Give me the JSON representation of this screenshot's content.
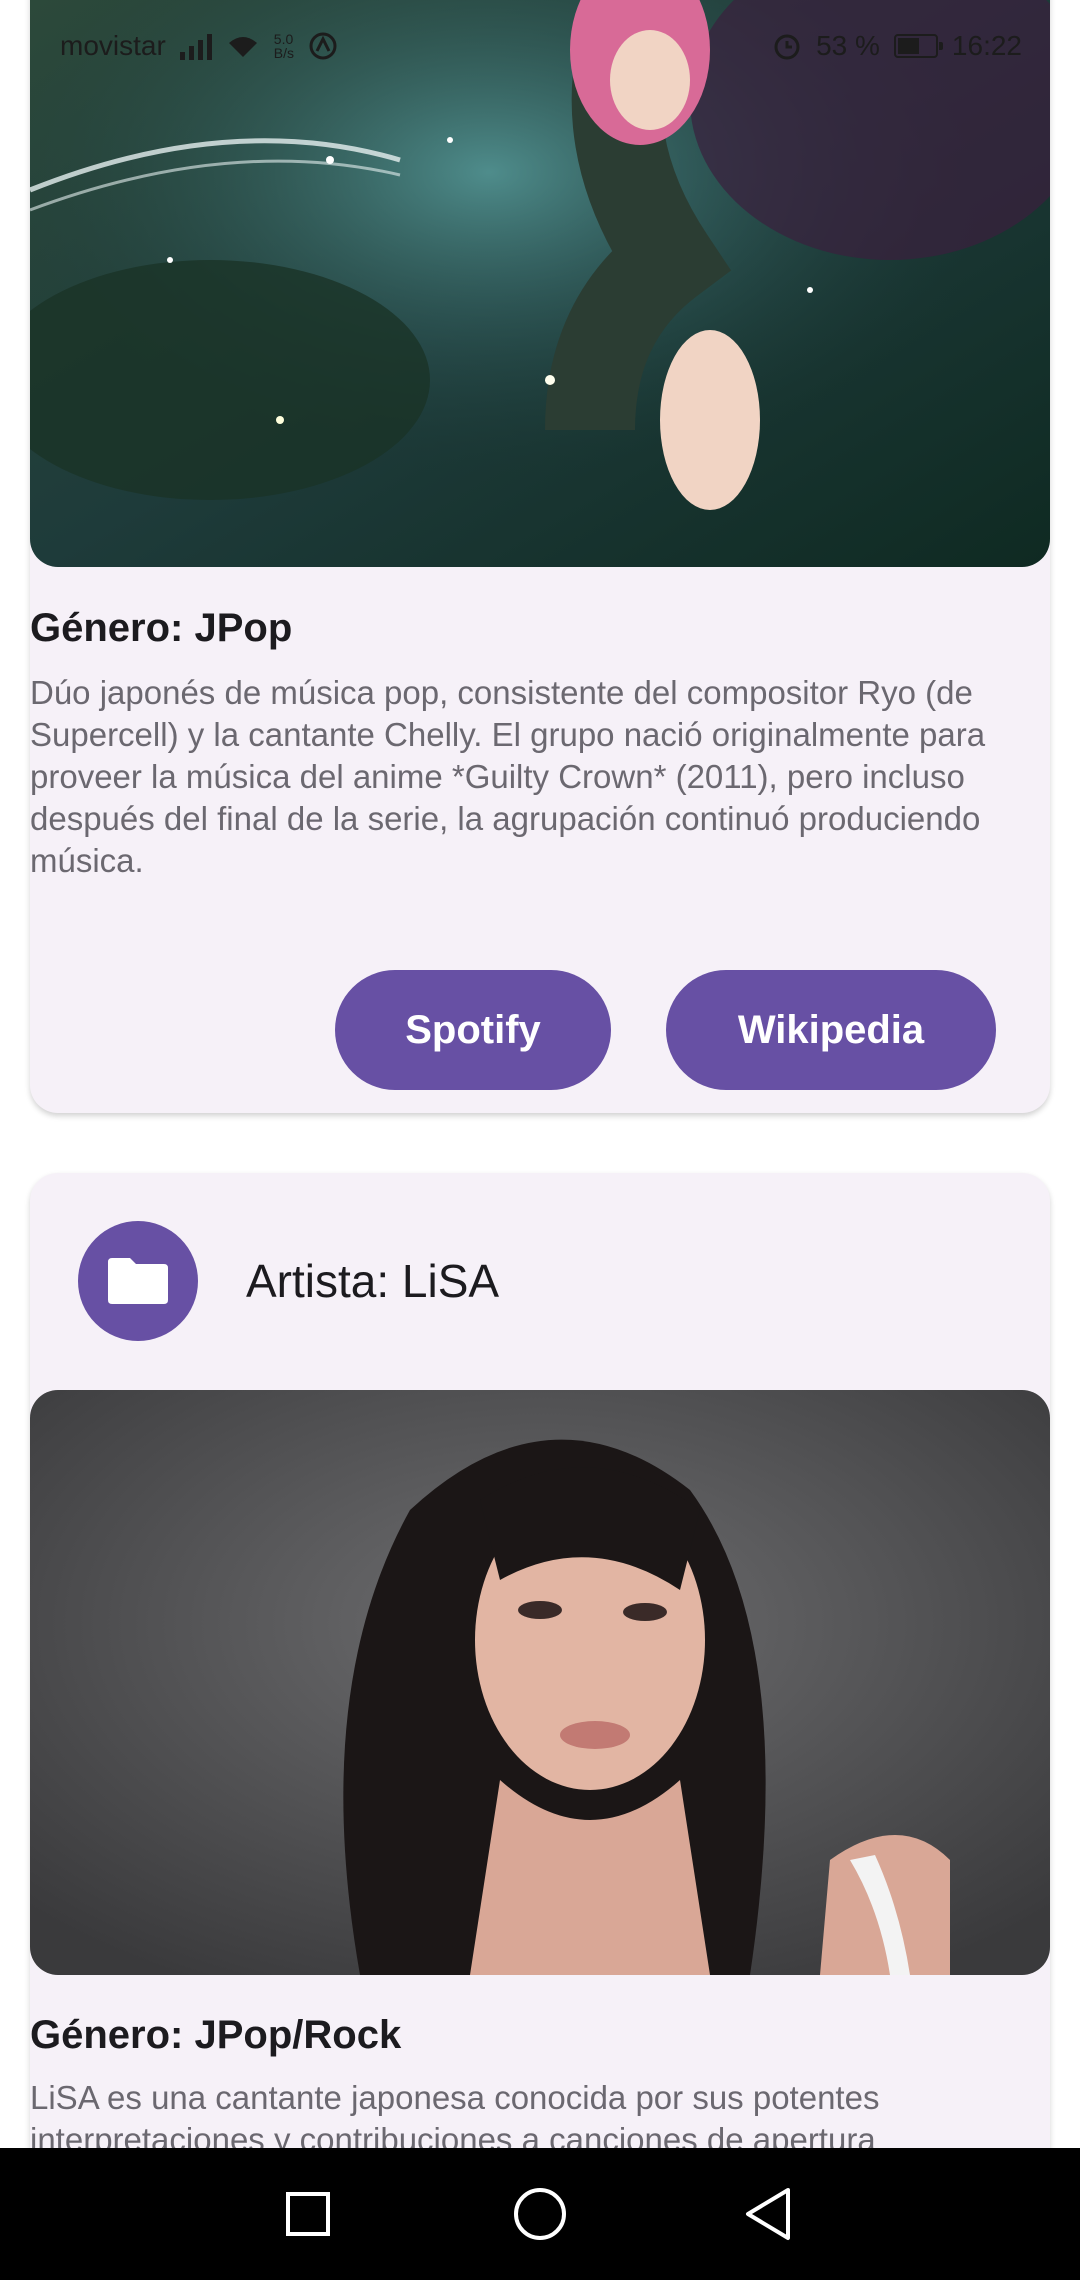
{
  "status_bar": {
    "carrier": "movistar",
    "speed_value": "5.0",
    "speed_unit": "B/s",
    "battery": "53 %",
    "time": "16:22"
  },
  "cards": [
    {
      "genre": "Género: JPop",
      "description": "Dúo japonés de música pop, consistente del compositor Ryo (de Supercell) y la cantante Chelly. El grupo nació originalmente para proveer la música del anime *Guilty Crown* (2011), pero incluso después del final de la serie, la agrupación continuó produciendo música.",
      "buttons": {
        "spotify": "Spotify",
        "wikipedia": "Wikipedia"
      }
    },
    {
      "artist": "Artista: LiSA",
      "genre": "Género: JPop/Rock",
      "description": "LiSA es una cantante japonesa conocida por sus potentes interpretaciones y contribuciones a canciones de apertura"
    }
  ],
  "icons": {
    "avatar": "folder-icon",
    "nav_back": "back-triangle-icon",
    "nav_home": "home-circle-icon",
    "nav_recent": "recents-square-icon"
  },
  "colors": {
    "accent": "#6750a4",
    "card_bg": "#f6f1f8",
    "text_primary": "#1c1b1f",
    "text_secondary": "#6b6870"
  }
}
